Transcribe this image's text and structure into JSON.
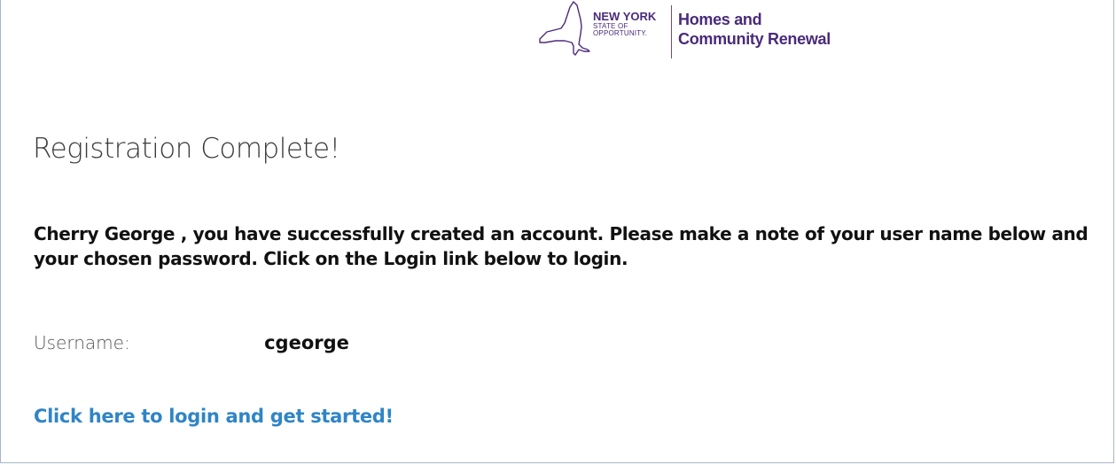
{
  "header": {
    "state_name": "NEW YORK",
    "state_tagline_line1": "STATE OF",
    "state_tagline_line2": "OPPORTUNITY.",
    "agency_line1": "Homes and",
    "agency_line2": "Community Renewal"
  },
  "main": {
    "title": "Registration Complete!",
    "message": "Cherry George , you have successfully created an account. Please make a note of your user name below and your chosen password. Click on the Login link below to login.",
    "username_label": "Username:",
    "username_value": "cgeorge",
    "login_link": "Click here to login and get started!"
  },
  "colors": {
    "brand_purple": "#4a2a7a",
    "link_blue": "#2f85c6",
    "frame_border": "#a9b6c6"
  },
  "icons": {
    "logo": "new-york-state-outline"
  }
}
